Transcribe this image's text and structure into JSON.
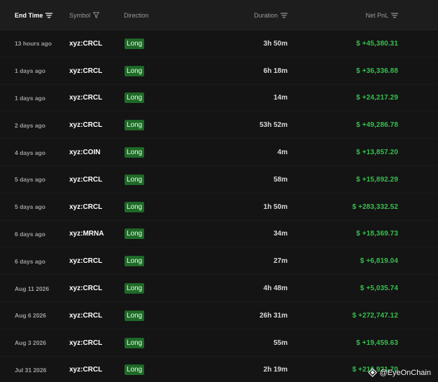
{
  "header": {
    "end_time": "End Time",
    "symbol": "Symbol",
    "direction": "Direction",
    "duration": "Duration",
    "net_pnl": "Net PnL"
  },
  "rows": [
    {
      "time": "13 hours ago",
      "symbol": "xyz:CRCL",
      "direction": "Long",
      "duration": "3h 50m",
      "pnl": "$ +45,380.31"
    },
    {
      "time": "1 days ago",
      "symbol": "xyz:CRCL",
      "direction": "Long",
      "duration": "6h 18m",
      "pnl": "$ +36,336.88"
    },
    {
      "time": "1 days ago",
      "symbol": "xyz:CRCL",
      "direction": "Long",
      "duration": "14m",
      "pnl": "$ +24,217.29"
    },
    {
      "time": "2 days ago",
      "symbol": "xyz:CRCL",
      "direction": "Long",
      "duration": "53h 52m",
      "pnl": "$ +49,286.78"
    },
    {
      "time": "4 days ago",
      "symbol": "xyz:COIN",
      "direction": "Long",
      "duration": "4m",
      "pnl": "$ +13,857.20"
    },
    {
      "time": "5 days ago",
      "symbol": "xyz:CRCL",
      "direction": "Long",
      "duration": "58m",
      "pnl": "$ +15,892.29"
    },
    {
      "time": "5 days ago",
      "symbol": "xyz:CRCL",
      "direction": "Long",
      "duration": "1h 50m",
      "pnl": "$ +283,332.52"
    },
    {
      "time": "6 days ago",
      "symbol": "xyz:MRNA",
      "direction": "Long",
      "duration": "34m",
      "pnl": "$ +18,369.73"
    },
    {
      "time": "6 days ago",
      "symbol": "xyz:CRCL",
      "direction": "Long",
      "duration": "27m",
      "pnl": "$ +6,819.04"
    },
    {
      "time": "Aug 11 2026",
      "symbol": "xyz:CRCL",
      "direction": "Long",
      "duration": "4h 48m",
      "pnl": "$ +5,035.74"
    },
    {
      "time": "Aug 6 2026",
      "symbol": "xyz:CRCL",
      "direction": "Long",
      "duration": "26h 31m",
      "pnl": "$ +272,747.12"
    },
    {
      "time": "Aug 3 2026",
      "symbol": "xyz:CRCL",
      "direction": "Long",
      "duration": "55m",
      "pnl": "$ +19,459.63"
    },
    {
      "time": "Jul 31 2026",
      "symbol": "xyz:CRCL",
      "direction": "Long",
      "duration": "2h 19m",
      "pnl": "$ +216,921.70"
    }
  ],
  "watermark": {
    "text": "@EyeOnChain",
    "icon": "diamond-logo-icon"
  },
  "colors": {
    "background": "#141414",
    "header": "#1d1d1d",
    "positive": "#35c04e",
    "badge": "#1e6a27"
  }
}
